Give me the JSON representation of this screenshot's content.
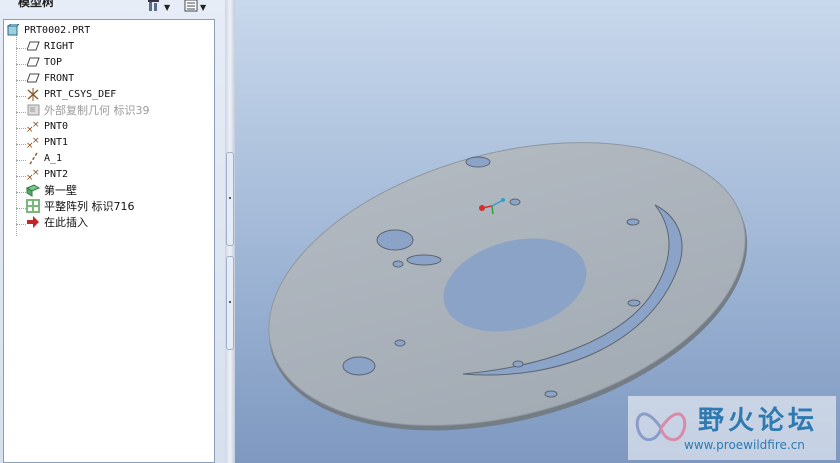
{
  "panel": {
    "title": "模型树",
    "header_icons": [
      "settings-icon",
      "tree-columns-icon"
    ]
  },
  "tree": {
    "root": {
      "label": "PRT0002.PRT",
      "icon": "part-icon"
    },
    "items": [
      {
        "label": "RIGHT",
        "icon": "datum-plane-icon"
      },
      {
        "label": "TOP",
        "icon": "datum-plane-icon"
      },
      {
        "label": "FRONT",
        "icon": "datum-plane-icon"
      },
      {
        "label": "PRT_CSYS_DEF",
        "icon": "coordinate-system-icon"
      },
      {
        "label": "外部复制几何 标识39",
        "icon": "external-copy-geometry-icon",
        "dim": true
      },
      {
        "label": "PNT0",
        "icon": "datum-point-icon"
      },
      {
        "label": "PNT1",
        "icon": "datum-point-icon"
      },
      {
        "label": "A_1",
        "icon": "datum-axis-icon"
      },
      {
        "label": "PNT2",
        "icon": "datum-point-icon"
      },
      {
        "label": "第一壁",
        "icon": "sheetmetal-wall-icon"
      },
      {
        "label": "平整阵列 标识716",
        "icon": "pattern-icon"
      },
      {
        "label": "在此插入",
        "icon": "insert-here-arrow-icon"
      }
    ]
  },
  "viewport": {
    "model": "flat-plate-with-holes",
    "plate_color": "#a9b1ba",
    "background_top": "#c8d8ec",
    "background_bottom": "#7e98c0"
  },
  "watermark": {
    "title": "野火论坛",
    "url": "www.proewildfire.cn",
    "color": "#2f7ab0"
  }
}
